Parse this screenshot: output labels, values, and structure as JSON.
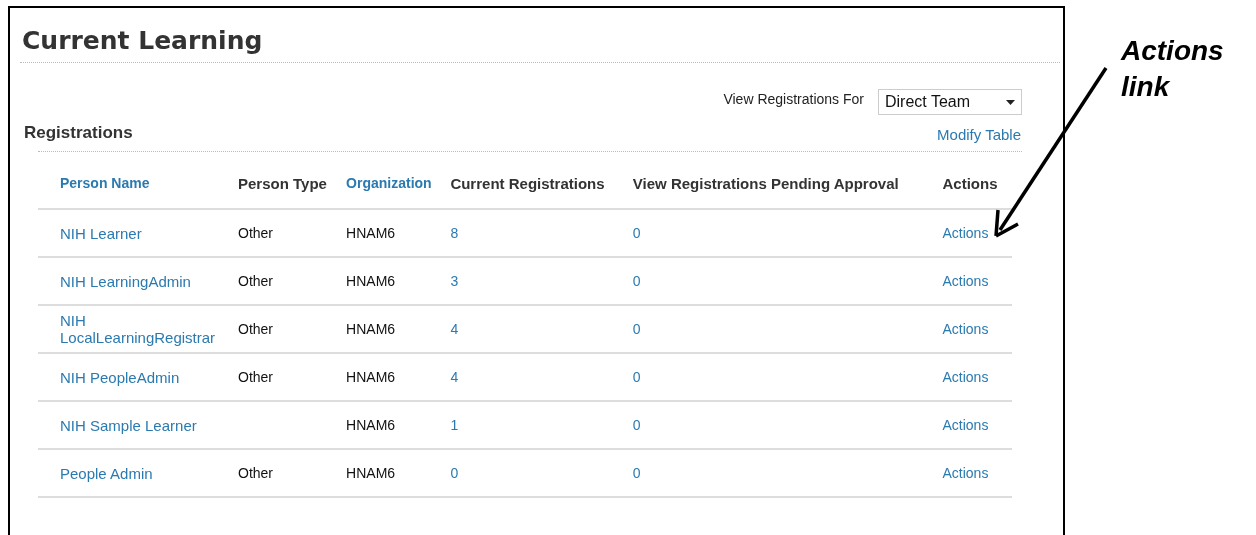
{
  "page": {
    "title": "Current Learning"
  },
  "filter": {
    "label": "View Registrations For",
    "value": "Direct Team"
  },
  "section": {
    "title": "Registrations",
    "link": "Modify Table"
  },
  "table": {
    "columns": [
      {
        "label": "Person Name",
        "sortable": true
      },
      {
        "label": "Person Type",
        "sortable": false
      },
      {
        "label": "Organization",
        "sortable": true
      },
      {
        "label": "Current Registrations",
        "sortable": false
      },
      {
        "label": "View Registrations Pending Approval",
        "sortable": false
      },
      {
        "label": "Actions",
        "sortable": false
      }
    ],
    "rows": [
      {
        "name": "NIH Learner",
        "type": "Other",
        "org": "HNAM6",
        "current": "8",
        "pending": "0",
        "action": "Actions"
      },
      {
        "name": "NIH LearningAdmin",
        "type": "Other",
        "org": "HNAM6",
        "current": "3",
        "pending": "0",
        "action": "Actions"
      },
      {
        "name": "NIH LocalLearningRegistrar",
        "type": "Other",
        "org": "HNAM6",
        "current": "4",
        "pending": "0",
        "action": "Actions"
      },
      {
        "name": "NIH PeopleAdmin",
        "type": "Other",
        "org": "HNAM6",
        "current": "4",
        "pending": "0",
        "action": "Actions"
      },
      {
        "name": "NIH Sample Learner",
        "org": "HNAM6",
        "current": "1",
        "pending": "0",
        "action": "Actions"
      },
      {
        "name": "People Admin",
        "type": "Other",
        "org": "HNAM6",
        "current": "0",
        "pending": "0",
        "action": "Actions"
      }
    ]
  },
  "callout": {
    "text": "Actions link"
  }
}
